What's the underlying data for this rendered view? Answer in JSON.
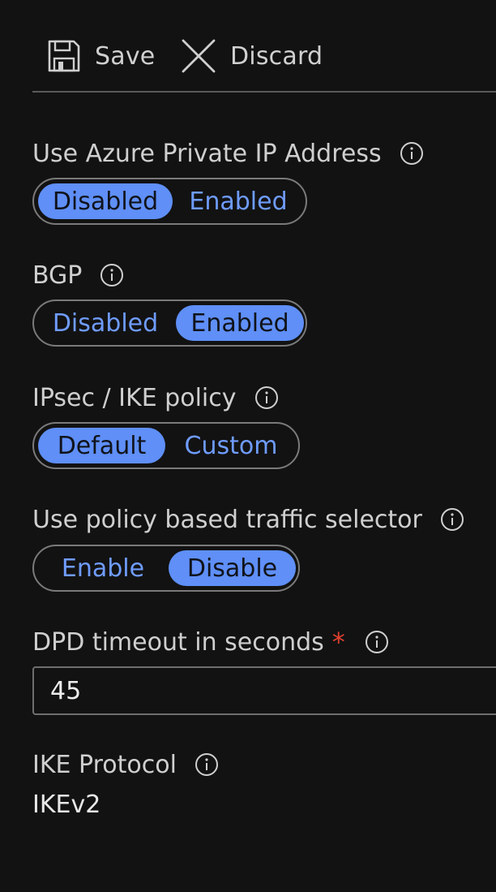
{
  "toolbar": {
    "save_label": "Save",
    "save_icon": "save-floppy-icon",
    "discard_label": "Discard",
    "discard_icon": "close-x-icon"
  },
  "fields": {
    "private_ip": {
      "label": "Use Azure Private IP Address",
      "options": [
        "Disabled",
        "Enabled"
      ],
      "selected": "Disabled"
    },
    "bgp": {
      "label": "BGP",
      "options": [
        "Disabled",
        "Enabled"
      ],
      "selected": "Enabled"
    },
    "ipsec": {
      "label": "IPsec / IKE policy",
      "options": [
        "Default",
        "Custom"
      ],
      "selected": "Default"
    },
    "policy_selector": {
      "label": "Use policy based traffic selector",
      "options": [
        "Enable",
        "Disable"
      ],
      "selected": "Disable"
    },
    "dpd_timeout": {
      "label": "DPD timeout in seconds",
      "required_marker": "*",
      "value": "45"
    },
    "ike_protocol": {
      "label": "IKE Protocol",
      "value": "IKEv2"
    }
  },
  "colors": {
    "background": "#121212",
    "accent": "#5f8ff7",
    "accent_text": "#6f9cff",
    "required": "#e2412f",
    "border": "#7a7a7a"
  }
}
